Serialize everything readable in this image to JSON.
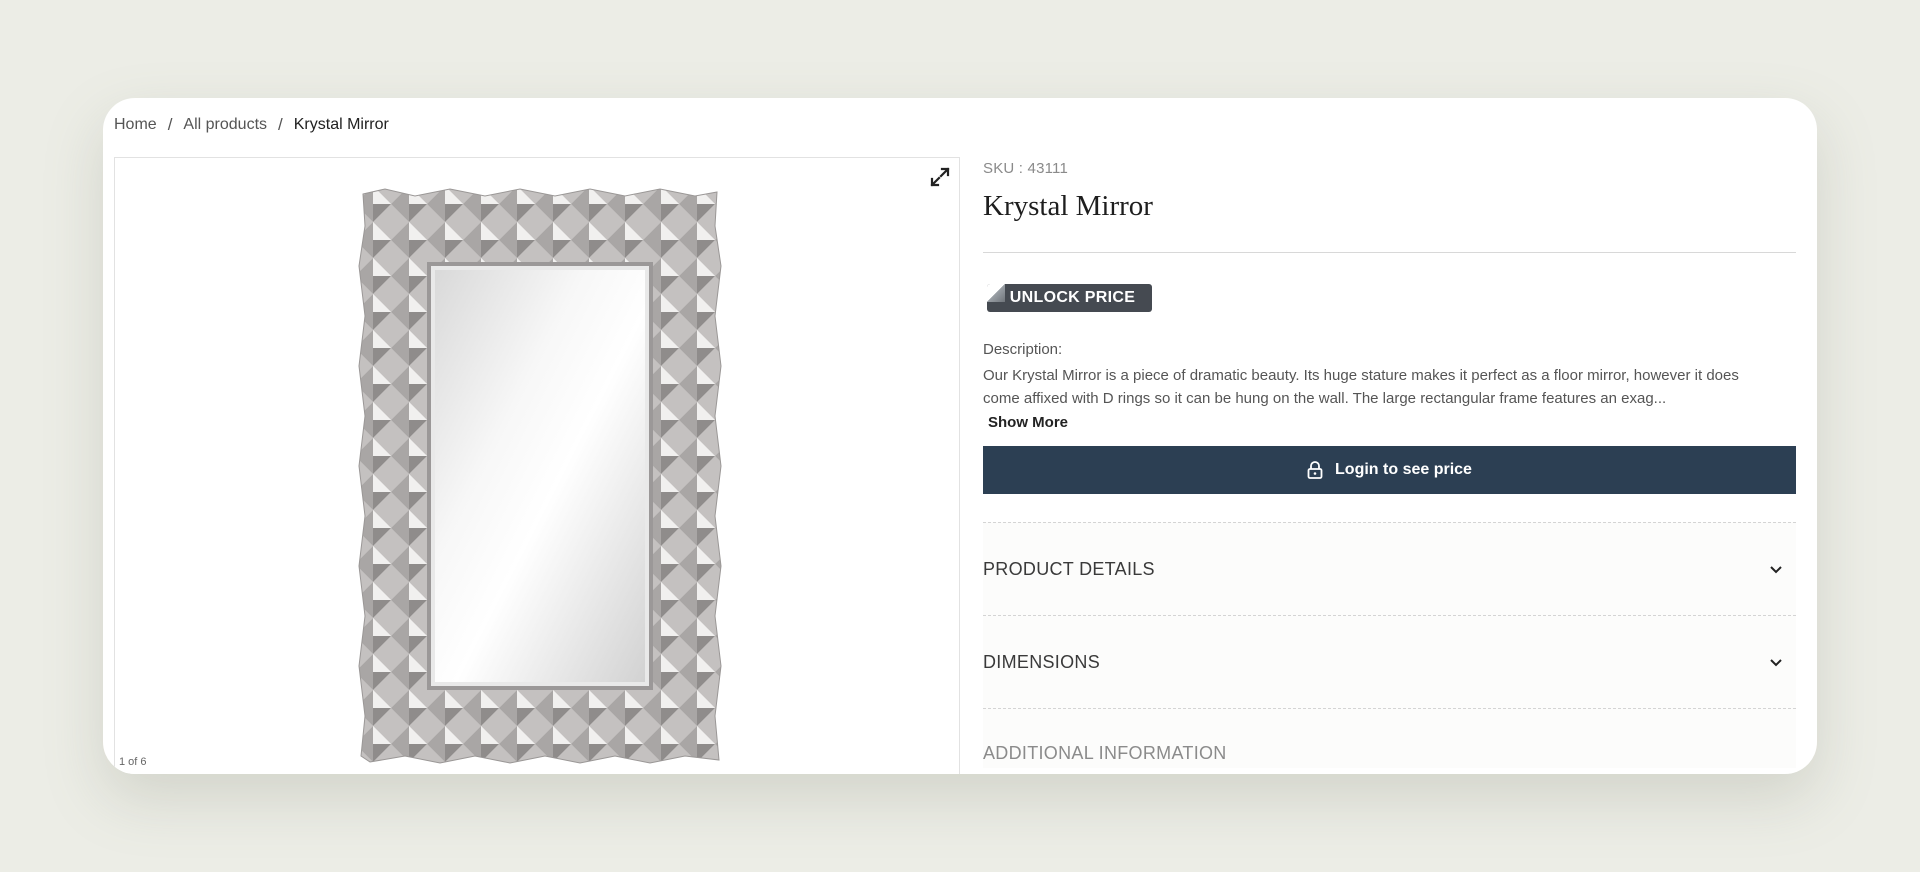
{
  "breadcrumb": {
    "items": [
      "Home",
      "All products"
    ],
    "current": "Krystal Mirror",
    "separator": "/"
  },
  "gallery": {
    "counter": "1 of 6",
    "expand_icon": "expand-icon"
  },
  "product": {
    "sku": "SKU : 43111",
    "title": "Krystal Mirror",
    "unlock_label": "UNLOCK PRICE",
    "description_label": "Description:",
    "description_text": "Our Krystal Mirror is a piece of dramatic beauty. Its huge stature makes it perfect as a floor mirror, however it does come affixed with D rings so it can be hung on the wall. The large rectangular frame features an exag...",
    "show_more": "Show More",
    "login_button": "Login to see price"
  },
  "accordion": {
    "items": [
      "PRODUCT DETAILS",
      "DIMENSIONS"
    ],
    "partial": "ADDITIONAL INFORMATION"
  },
  "colors": {
    "page_bg": "#ecede6",
    "login_button_bg": "#2c3f53",
    "badge_bg": "#454a51"
  }
}
